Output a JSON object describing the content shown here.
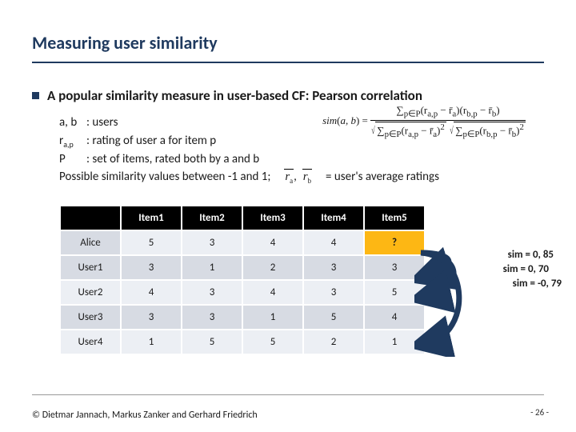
{
  "title": "Measuring user similarity",
  "bullet": "A popular similarity measure in user-based CF: Pearson correlation",
  "defs": {
    "ab": "a, b",
    "ab_desc": ": users",
    "rap_html": "r<sub>a,p</sub>",
    "rap_desc": ": rating of user a for item p",
    "P": "P",
    "P_desc": ": set of items, rated both by a and b",
    "range": "Possible similarity values between -1 and 1;"
  },
  "avg_label": "= user's average ratings",
  "chart_data": {
    "type": "table",
    "columns": [
      "",
      "Item1",
      "Item2",
      "Item3",
      "Item4",
      "Item5"
    ],
    "rows": [
      {
        "name": "Alice",
        "values": [
          "5",
          "3",
          "4",
          "4",
          "?"
        ]
      },
      {
        "name": "User1",
        "values": [
          "3",
          "1",
          "2",
          "3",
          "3"
        ]
      },
      {
        "name": "User2",
        "values": [
          "4",
          "3",
          "4",
          "3",
          "5"
        ]
      },
      {
        "name": "User3",
        "values": [
          "3",
          "3",
          "1",
          "5",
          "4"
        ]
      },
      {
        "name": "User4",
        "values": [
          "1",
          "5",
          "5",
          "2",
          "1"
        ]
      }
    ]
  },
  "sims": [
    "sim  = 0, 85",
    "sim  = 0, 70",
    "sim  = -0, 79"
  ],
  "footer": "© Dietmar Jannach, Markus Zanker and Gerhard Friedrich",
  "page": "- 26 -"
}
